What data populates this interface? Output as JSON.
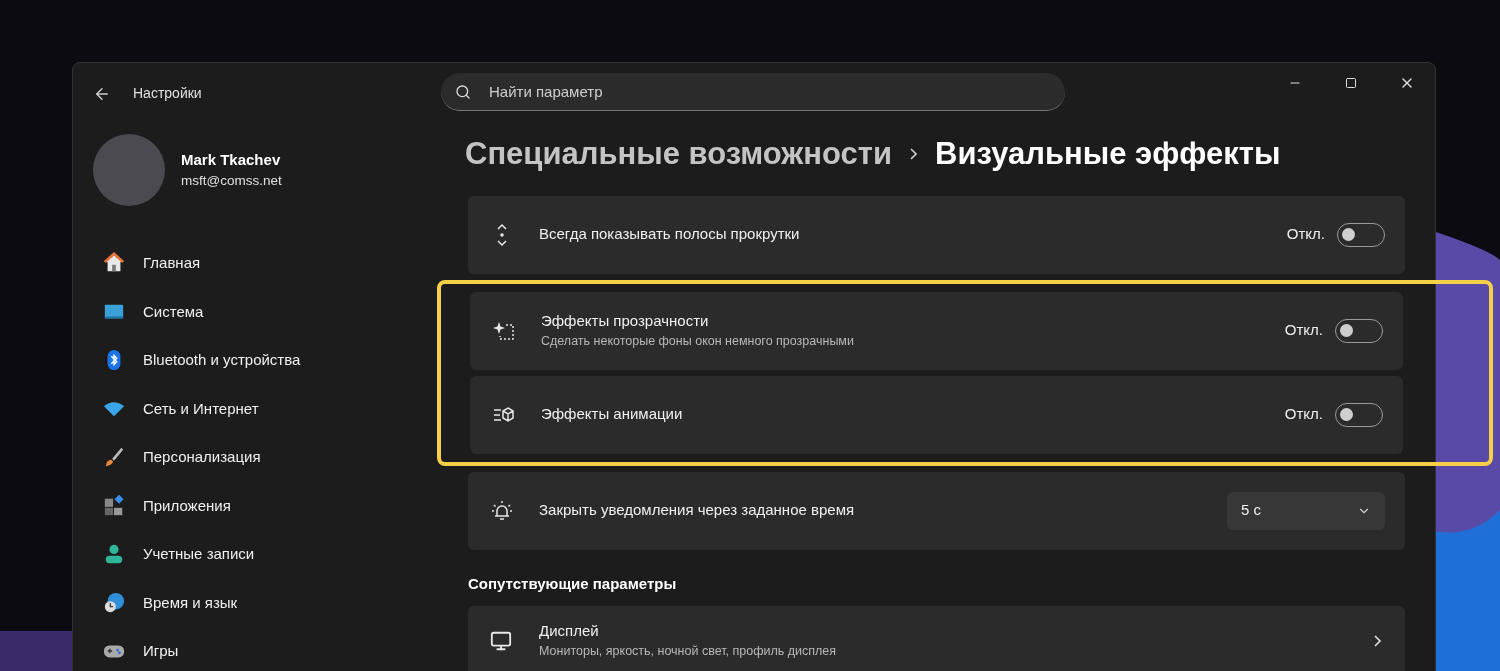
{
  "window": {
    "title": "Настройки"
  },
  "search": {
    "placeholder": "Найти параметр"
  },
  "user": {
    "name": "Mark Tkachev",
    "email": "msft@comss.net"
  },
  "nav": [
    {
      "label": "Главная",
      "selected": false
    },
    {
      "label": "Система",
      "selected": false
    },
    {
      "label": "Bluetooth и устройства",
      "selected": false
    },
    {
      "label": "Сеть и Интернет",
      "selected": false
    },
    {
      "label": "Персонализация",
      "selected": false
    },
    {
      "label": "Приложения",
      "selected": false
    },
    {
      "label": "Учетные записи",
      "selected": false
    },
    {
      "label": "Время и язык",
      "selected": false
    },
    {
      "label": "Игры",
      "selected": false
    }
  ],
  "breadcrumb": [
    "Специальные возможности",
    "Визуальные эффекты"
  ],
  "settings": [
    {
      "kind": "toggle",
      "label": "Всегда показывать полосы прокрутки",
      "state_label": "Откл.",
      "on": false,
      "highlighted": false
    },
    {
      "kind": "toggle",
      "label": "Эффекты прозрачности",
      "description": "Сделать некоторые фоны окон немного прозрачными",
      "state_label": "Откл.",
      "on": false,
      "highlighted": true
    },
    {
      "kind": "toggle",
      "label": "Эффекты анимации",
      "state_label": "Откл.",
      "on": false,
      "highlighted": true
    },
    {
      "kind": "dropdown",
      "label": "Закрыть уведомления через заданное время",
      "value": "5 с",
      "highlighted": false
    }
  ],
  "related": {
    "title": "Сопутствующие параметры",
    "items": [
      {
        "label": "Дисплей",
        "description": "Мониторы, яркость, ночной свет, профиль дисплея"
      }
    ]
  }
}
